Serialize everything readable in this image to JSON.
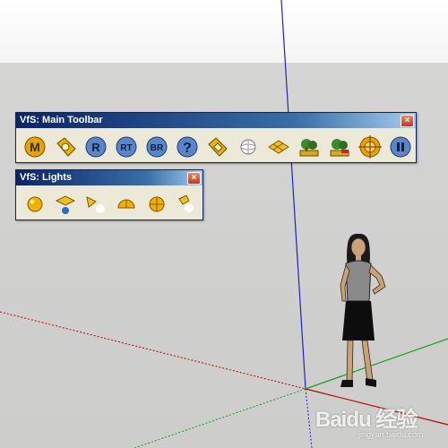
{
  "main_toolbar": {
    "title": "VfS: Main Toolbar",
    "close_symbol": "×",
    "buttons": [
      {
        "icon": "m-logo-icon",
        "letter": "M"
      },
      {
        "icon": "tag-settings-icon"
      },
      {
        "icon": "render-icon",
        "letter": "R"
      },
      {
        "icon": "render-region-icon",
        "letter": "RT"
      },
      {
        "icon": "batch-render-icon",
        "letter": "BR"
      },
      {
        "icon": "help-icon",
        "letter": "?"
      },
      {
        "icon": "material-tag-icon"
      },
      {
        "icon": "sphere-light-icon"
      },
      {
        "icon": "plane-grid-icon"
      },
      {
        "icon": "scene-tree-icon"
      },
      {
        "icon": "scene-tree-red-icon"
      },
      {
        "icon": "target-icon"
      },
      {
        "icon": "pause-icon"
      }
    ]
  },
  "lights_toolbar": {
    "title": "VfS: Lights",
    "close_symbol": "×",
    "buttons": [
      {
        "icon": "omni-light-icon"
      },
      {
        "icon": "area-light-icon"
      },
      {
        "icon": "spot-light-icon"
      },
      {
        "icon": "dome-light-icon"
      },
      {
        "icon": "sphere-light-icon"
      },
      {
        "icon": "ies-light-icon"
      }
    ]
  },
  "watermark": {
    "brand": "Baidu 经验",
    "url": "jingyan.baidu.com"
  },
  "colors": {
    "axis_blue": "#2020d0",
    "axis_red": "#c00000",
    "axis_green": "#18a018",
    "titlebar": "#0a246a"
  }
}
